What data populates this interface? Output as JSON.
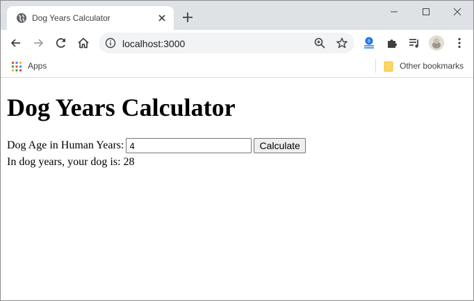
{
  "browser": {
    "tab_title": "Dog Years Calculator",
    "url": "localhost:3000",
    "bookmarks": {
      "apps_label": "Apps",
      "other_label": "Other bookmarks"
    }
  },
  "page": {
    "heading": "Dog Years Calculator",
    "form": {
      "label": "Dog Age in Human Years:",
      "input_value": "4",
      "button_label": "Calculate"
    },
    "result_prefix": "In dog years, your dog is:",
    "result_value": "28"
  },
  "colors": {
    "tab_strip": "#dee1e6",
    "omnibox": "#f1f3f4",
    "folder": "#fdd663"
  }
}
